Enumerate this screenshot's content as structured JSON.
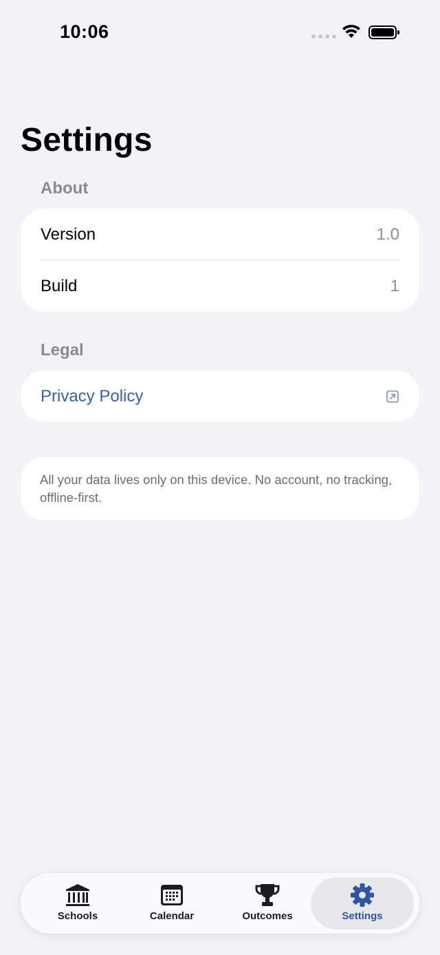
{
  "status": {
    "time": "10:06"
  },
  "title": "Settings",
  "about": {
    "header": "About",
    "rows": [
      {
        "label": "Version",
        "value": "1.0"
      },
      {
        "label": "Build",
        "value": "1"
      }
    ]
  },
  "legal": {
    "header": "Legal",
    "privacy_label": "Privacy Policy"
  },
  "note": "All your data lives only on this device. No account, no tracking, offline-first.",
  "tabs": [
    {
      "label": "Schools",
      "icon": "building-columns-icon"
    },
    {
      "label": "Calendar",
      "icon": "calendar-icon"
    },
    {
      "label": "Outcomes",
      "icon": "trophy-icon"
    },
    {
      "label": "Settings",
      "icon": "gear-icon",
      "active": true
    }
  ],
  "colors": {
    "accent": "#2f55a4",
    "link": "#3a5fa0",
    "background": "#f2f2f7"
  }
}
